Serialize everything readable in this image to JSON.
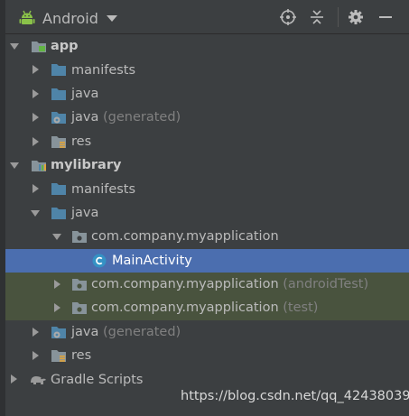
{
  "toolbar": {
    "view_label": "Android",
    "icons": [
      "locate-target-icon",
      "collapse-all-icon",
      "settings-gear-icon",
      "hide-minus-icon"
    ]
  },
  "tree": [
    {
      "label": "app",
      "suffix": "",
      "icon": "module-folder-icon",
      "state": "expanded"
    },
    {
      "label": "manifests",
      "suffix": "",
      "icon": "folder-icon",
      "state": "collapsed"
    },
    {
      "label": "java",
      "suffix": "",
      "icon": "folder-icon",
      "state": "collapsed"
    },
    {
      "label": "java",
      "suffix": "(generated)",
      "icon": "generated-java-folder-icon",
      "state": "collapsed"
    },
    {
      "label": "res",
      "suffix": "",
      "icon": "res-folder-icon",
      "state": "collapsed"
    },
    {
      "label": "mylibrary",
      "suffix": "",
      "icon": "library-module-icon",
      "state": "expanded"
    },
    {
      "label": "manifests",
      "suffix": "",
      "icon": "folder-icon",
      "state": "collapsed"
    },
    {
      "label": "java",
      "suffix": "",
      "icon": "folder-icon",
      "state": "expanded"
    },
    {
      "label": "com.company.myapplication",
      "suffix": "",
      "icon": "package-icon",
      "state": "expanded"
    },
    {
      "label": "MainActivity",
      "suffix": "",
      "icon": "class-c-icon",
      "state": "leaf",
      "selected": true
    },
    {
      "label": "com.company.myapplication",
      "suffix": "(androidTest)",
      "icon": "package-icon",
      "state": "collapsed"
    },
    {
      "label": "com.company.myapplication",
      "suffix": "(test)",
      "icon": "package-icon",
      "state": "collapsed"
    },
    {
      "label": "java",
      "suffix": "(generated)",
      "icon": "generated-java-folder-icon",
      "state": "collapsed"
    },
    {
      "label": "res",
      "suffix": "",
      "icon": "res-folder-icon",
      "state": "collapsed"
    },
    {
      "label": "Gradle Scripts",
      "suffix": "",
      "icon": "gradle-elephant-icon",
      "state": "collapsed"
    }
  ],
  "watermark": "https://blog.csdn.net/qq_42438039",
  "colors": {
    "background": "#3c3f41",
    "selection": "#4b6eaf",
    "test_source_highlight": "#49533e",
    "annotation_underline": "#e02020"
  }
}
